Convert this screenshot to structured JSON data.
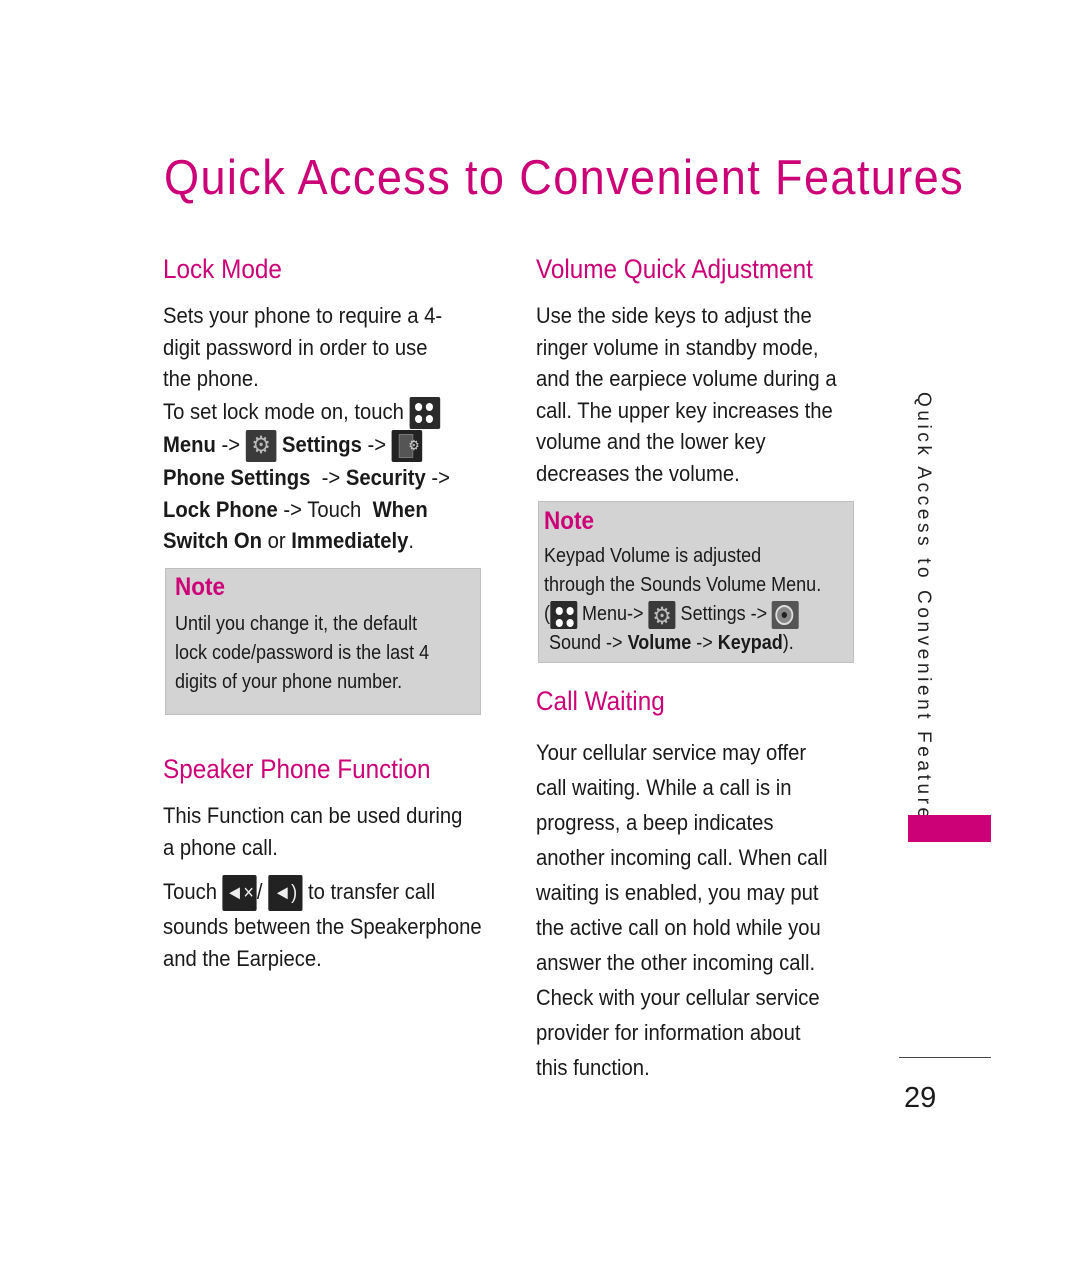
{
  "page": {
    "title": "Quick Access to Convenient Features",
    "side_tab": "Quick Access to Convenient Features",
    "page_number": "29",
    "accent_color": "#cc0077"
  },
  "lock_mode": {
    "heading": "Lock Mode",
    "lines": [
      "Sets your phone to require a 4-",
      "digit password in order to use",
      "the phone."
    ],
    "steps": {
      "l1_text": "To set lock mode on, touch",
      "menu": "Menu",
      "arrow": "->",
      "settings": "Settings",
      "phone_settings": "Phone Settings",
      "security": "Security",
      "lock_phone": "Lock Phone",
      "touch": "Touch",
      "when": "When",
      "switch_on": "Switch On",
      "or": "or",
      "immediately": "Immediately",
      "period": "."
    },
    "icons": [
      "menu-grid-icon",
      "settings-gear-icon",
      "phone-settings-icon"
    ],
    "note": {
      "heading": "Note",
      "lines": [
        "Until you change it, the default",
        "lock code/password is the last 4",
        "digits of your phone number."
      ]
    }
  },
  "speaker_phone": {
    "heading": "Speaker Phone Function",
    "lines": [
      "This Function can be used during",
      "a phone call."
    ],
    "touch": "Touch",
    "slash": "/",
    "after_icons": "to transfer call",
    "lines2": [
      "sounds between the Speakerphone",
      "and the Earpiece."
    ],
    "icons": [
      "speaker-mute-icon",
      "speaker-on-icon"
    ]
  },
  "volume": {
    "heading": "Volume Quick Adjustment",
    "lines": [
      "Use the side keys to adjust the",
      "ringer volume in standby mode,",
      "and the earpiece volume during a",
      "call. The upper key increases the",
      "volume and the lower key",
      "decreases the volume."
    ],
    "note": {
      "heading": "Note",
      "lines": [
        "Keypad Volume is adjusted",
        "through the Sounds Volume Menu."
      ],
      "open_paren": "(",
      "menu": "Menu->",
      "settings": "Settings ->",
      "sound": "Sound ->",
      "volume": "Volume",
      "arrow": "->",
      "keypad": "Keypad",
      "close": ")."
    }
  },
  "call_waiting": {
    "heading": "Call Waiting",
    "lines": [
      "Your cellular service may offer",
      "call waiting. While a call is in",
      "progress, a beep indicates",
      "another incoming call. When call",
      "waiting is enabled, you may put",
      "the active call on hold while you",
      "answer the other incoming call.",
      "Check with your cellular service",
      "provider for information about",
      "this function."
    ]
  }
}
